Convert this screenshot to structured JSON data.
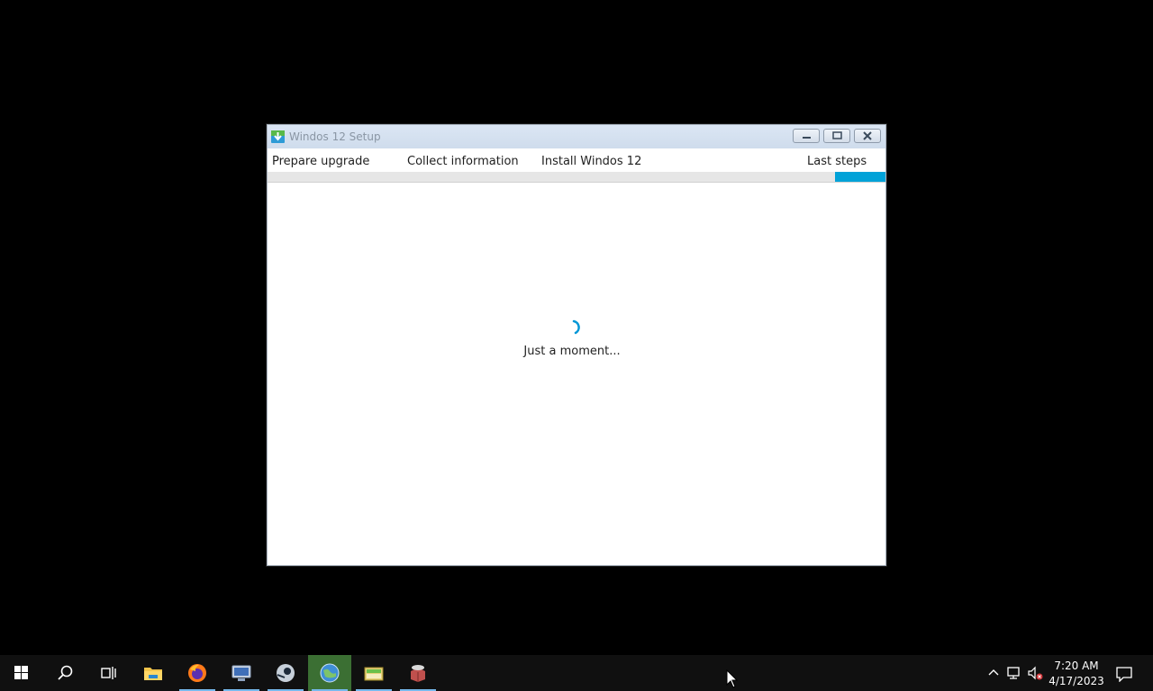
{
  "window": {
    "title": "Windos 12 Setup",
    "steps": [
      "Prepare upgrade",
      "Collect information",
      "Install Windos 12",
      "Last steps"
    ],
    "progress_step": 4,
    "status_text": "Just a moment..."
  },
  "taskbar": {
    "apps": [
      "start-icon",
      "search-icon",
      "task-view-icon",
      "file-explorer-icon",
      "firefox-icon",
      "network-app-icon",
      "steam-icon",
      "globe-app-icon",
      "archive-app-icon",
      "package-app-icon"
    ],
    "time": "7:20 AM",
    "date": "4/17/2023"
  },
  "colors": {
    "accent": "#00a2d8",
    "taskbar": "#101010"
  }
}
